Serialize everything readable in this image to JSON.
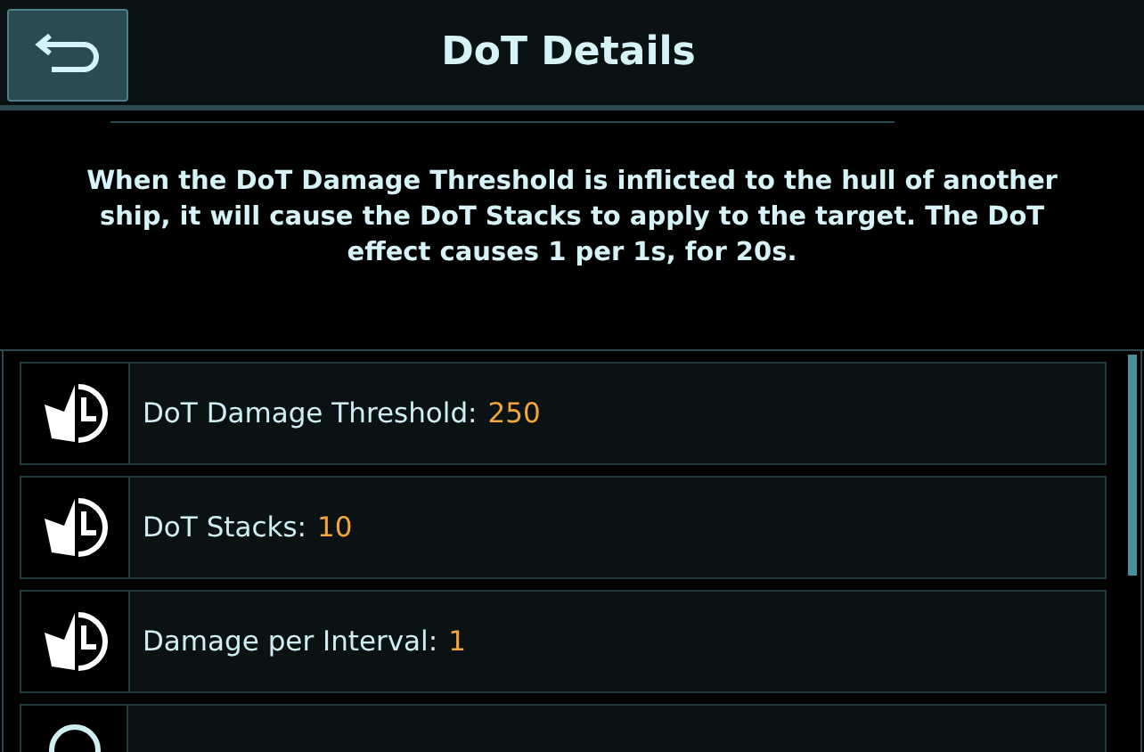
{
  "header": {
    "title": "DoT Details"
  },
  "description": "When the DoT Damage Threshold is inflicted to the hull of another ship, it will cause the DoT Stacks to apply to the target. The DoT effect causes 1 per 1s, for 20s.",
  "stats": [
    {
      "label": "DoT Damage Threshold:",
      "value": "250"
    },
    {
      "label": "DoT Stacks:",
      "value": "10"
    },
    {
      "label": "Damage per Interval:",
      "value": "1"
    }
  ]
}
